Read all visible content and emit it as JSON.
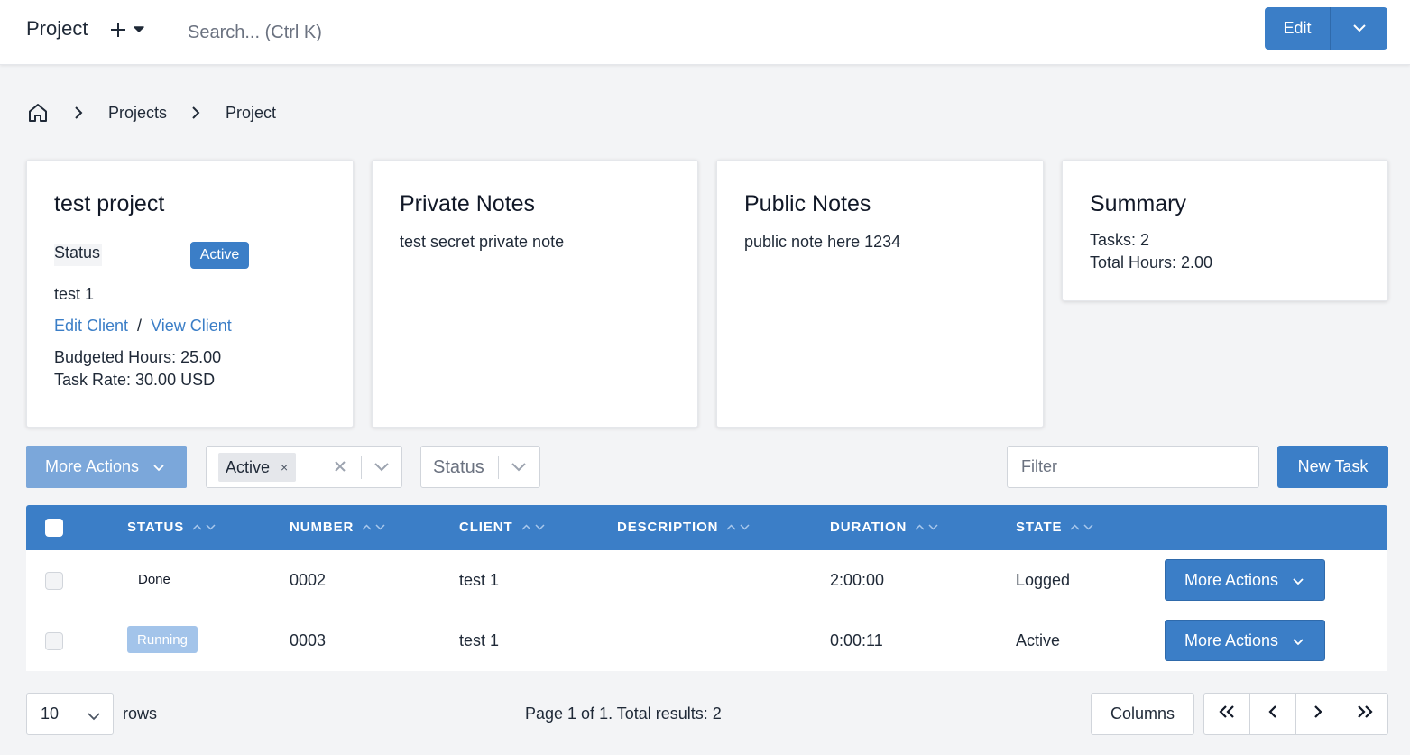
{
  "header": {
    "title": "Project",
    "search_placeholder": "Search... (Ctrl K)",
    "edit_label": "Edit"
  },
  "breadcrumb": {
    "items": [
      "Projects",
      "Project"
    ]
  },
  "project_card": {
    "title": "test project",
    "status_label": "Status",
    "status_value": "Active",
    "client_name": "test 1",
    "edit_client": "Edit Client",
    "separator": "/",
    "view_client": "View Client",
    "budgeted_hours": "Budgeted Hours: 25.00",
    "task_rate": "Task Rate: 30.00 USD"
  },
  "private_notes": {
    "title": "Private Notes",
    "text": "test secret private note"
  },
  "public_notes": {
    "title": "Public Notes",
    "text": "public note here 1234"
  },
  "summary": {
    "title": "Summary",
    "tasks": "Tasks: 2",
    "total_hours": "Total Hours: 2.00"
  },
  "toolbar": {
    "more_actions": "More Actions",
    "filter_chip": "Active",
    "chip_remove": "×",
    "status_placeholder": "Status",
    "filter_placeholder": "Filter",
    "new_task": "New Task"
  },
  "table": {
    "headers": [
      "STATUS",
      "NUMBER",
      "CLIENT",
      "DESCRIPTION",
      "DURATION",
      "STATE"
    ],
    "rows": [
      {
        "status": "Done",
        "number": "0002",
        "client": "test 1",
        "description": "",
        "duration": "2:00:00",
        "state": "Logged",
        "action": "More Actions"
      },
      {
        "status": "Running",
        "number": "0003",
        "client": "test 1",
        "description": "",
        "duration": "0:00:11",
        "state": "Active",
        "action": "More Actions"
      }
    ]
  },
  "footer": {
    "rows_value": "10",
    "rows_label": "rows",
    "page_info": "Page 1 of 1. Total results: 2",
    "columns": "Columns"
  },
  "colors": {
    "primary": "#3b7ec7",
    "primary_disabled": "#7ba7da",
    "running_badge": "#a3c4ea",
    "background": "#f3f4f6"
  },
  "icons": [
    "plus-icon",
    "chevron-down-icon",
    "home-icon",
    "chevron-right-icon",
    "close-icon",
    "sort-icon",
    "double-chevron-left-icon",
    "chevron-left-icon",
    "double-chevron-right-icon"
  ]
}
